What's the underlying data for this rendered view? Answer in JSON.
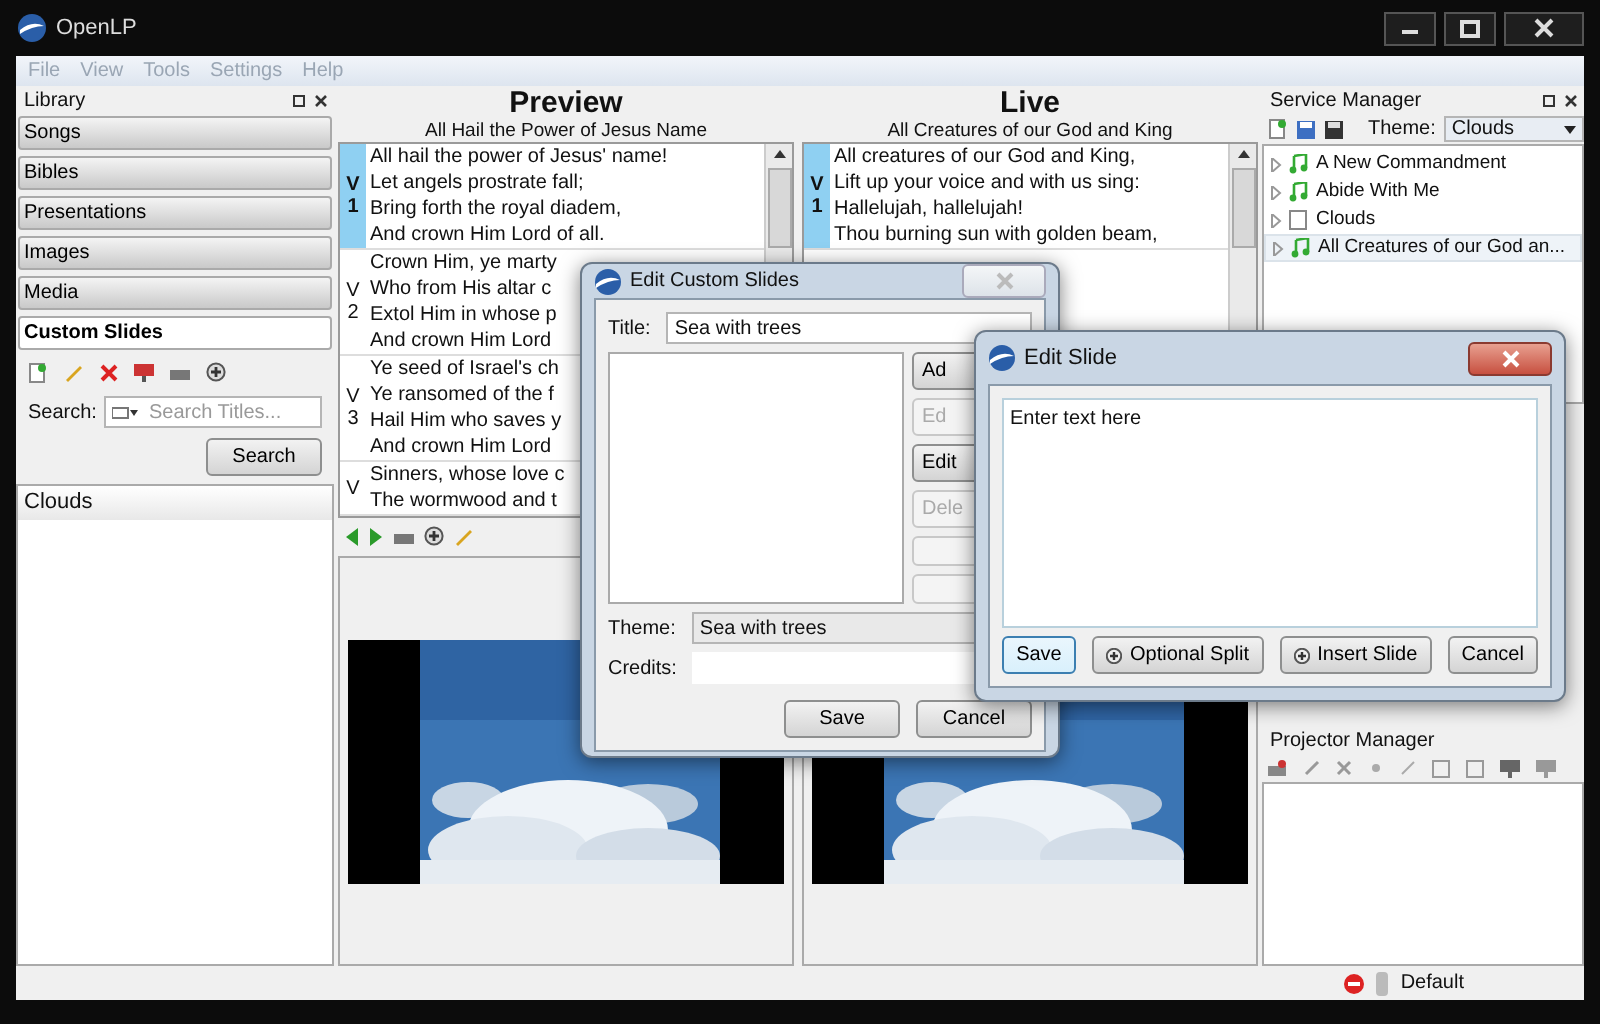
{
  "window": {
    "title": "OpenLP"
  },
  "menu": [
    {
      "label": "File",
      "disabled": true
    },
    {
      "label": "View",
      "disabled": true
    },
    {
      "label": "Tools",
      "disabled": true
    },
    {
      "label": "Settings",
      "disabled": true
    },
    {
      "label": "Help",
      "disabled": true
    }
  ],
  "library": {
    "title": "Library",
    "sections": [
      {
        "label": "Songs",
        "selected": false
      },
      {
        "label": "Bibles",
        "selected": false
      },
      {
        "label": "Presentations",
        "selected": false
      },
      {
        "label": "Images",
        "selected": false
      },
      {
        "label": "Media",
        "selected": false
      },
      {
        "label": "Custom Slides",
        "selected": true
      }
    ],
    "search_label": "Search:",
    "search_placeholder": "Search Titles...",
    "search_button": "Search",
    "items": [
      "Clouds"
    ]
  },
  "preview": {
    "title": "Preview",
    "subtitle": "All Hail the Power of Jesus Name",
    "slides": [
      {
        "tag": "V",
        "number": "1",
        "selected": true,
        "lines": [
          "All hail the power of Jesus' name!",
          "Let angels prostrate fall;",
          "Bring forth the royal diadem,",
          "And crown Him Lord of all."
        ]
      },
      {
        "tag": "V",
        "number": "2",
        "selected": false,
        "lines": [
          "Crown Him, ye marty",
          "Who from His altar c",
          "Extol Him in whose p",
          "And crown Him Lord"
        ]
      },
      {
        "tag": "V",
        "number": "3",
        "selected": false,
        "lines": [
          "Ye seed of Israel's ch",
          "Ye ransomed of the f",
          "Hail Him who saves y",
          "And crown Him Lord"
        ]
      },
      {
        "tag": "V",
        "selected": false,
        "lines": [
          "Sinners, whose love c",
          "The wormwood and t"
        ]
      }
    ]
  },
  "live": {
    "title": "Live",
    "subtitle": "All Creatures of our God and King",
    "slides": [
      {
        "tag": "V",
        "number": "1",
        "selected": true,
        "lines": [
          "All creatures of our God and King,",
          "Lift up your voice and with us sing:",
          "Hallelujah, hallelujah!",
          "Thou burning sun with golden beam,"
        ]
      }
    ]
  },
  "service": {
    "title": "Service Manager",
    "theme_label": "Theme:",
    "theme": "Clouds",
    "items": [
      {
        "label": "A New Commandment",
        "kind": "song",
        "expanded": false,
        "selected": false
      },
      {
        "label": "Abide With Me",
        "kind": "song",
        "expanded": false,
        "selected": false
      },
      {
        "label": "Clouds",
        "kind": "custom",
        "expanded": false,
        "selected": false
      },
      {
        "label": "All Creatures of our God an...",
        "kind": "song",
        "expanded": false,
        "selected": true
      }
    ]
  },
  "projector": {
    "title": "Projector Manager"
  },
  "status": {
    "theme": "Default"
  },
  "edit_custom": {
    "title": "Edit Custom Slides",
    "title_label": "Title:",
    "title_value": "Sea with trees",
    "side_buttons": [
      {
        "label": "Ad",
        "disabled": false
      },
      {
        "label": "Ed",
        "disabled": true
      },
      {
        "label": "Edit",
        "disabled": false
      },
      {
        "label": "Dele",
        "disabled": true
      },
      {
        "disabled": true
      },
      {
        "disabled": true
      }
    ],
    "theme_label": "Theme:",
    "theme": "Sea with trees",
    "credits_label": "Credits:",
    "buttons": [
      "Save",
      "Cancel"
    ]
  },
  "edit_slide": {
    "title": "Edit Slide",
    "text": "Enter text here",
    "buttons": [
      {
        "label": "Save",
        "kind": "default"
      },
      {
        "label": "Optional Split",
        "kind": "add"
      },
      {
        "label": "Insert Slide",
        "kind": "add"
      },
      {
        "label": "Cancel",
        "kind": "plain"
      }
    ]
  }
}
